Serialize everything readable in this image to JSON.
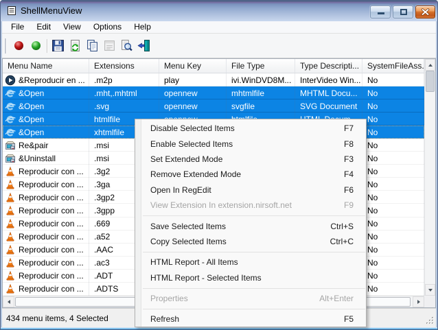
{
  "window": {
    "title": "ShellMenuView"
  },
  "menubar": {
    "items": [
      "File",
      "Edit",
      "View",
      "Options",
      "Help"
    ]
  },
  "toolbar": {
    "buttons": [
      {
        "name": "disable-selected",
        "icon": "red-circle-icon",
        "enabled": true
      },
      {
        "name": "enable-selected",
        "icon": "green-circle-icon",
        "enabled": true
      },
      {
        "name": "separator"
      },
      {
        "name": "save",
        "icon": "save-icon",
        "enabled": true
      },
      {
        "name": "refresh",
        "icon": "refresh-icon",
        "enabled": true
      },
      {
        "name": "copy",
        "icon": "copy-icon",
        "enabled": true
      },
      {
        "name": "properties",
        "icon": "properties-icon",
        "enabled": false
      },
      {
        "name": "find",
        "icon": "find-icon",
        "enabled": true
      },
      {
        "name": "exit",
        "icon": "exit-icon",
        "enabled": true
      }
    ]
  },
  "table": {
    "columns": [
      {
        "label": "Menu Name",
        "width": 126
      },
      {
        "label": "Extensions",
        "width": 102
      },
      {
        "label": "Menu Key",
        "width": 98
      },
      {
        "label": "File Type",
        "width": 100
      },
      {
        "label": "Type Descripti...",
        "width": 98
      },
      {
        "label": "SystemFileAss.",
        "width": 90
      }
    ],
    "rows": [
      {
        "icon": "windvd-icon",
        "selected": false,
        "focused": false,
        "cells": [
          "&Reproducir en ...",
          ".m2p",
          "play",
          "ivi.WinDVD8M...",
          "InterVideo Win...",
          "No"
        ]
      },
      {
        "icon": "ie-icon",
        "selected": true,
        "focused": false,
        "cells": [
          "&Open",
          ".mht,.mhtml",
          "opennew",
          "mhtmlfile",
          "MHTML Docu...",
          "No"
        ]
      },
      {
        "icon": "ie-icon",
        "selected": true,
        "focused": false,
        "cells": [
          "&Open",
          ".svg",
          "opennew",
          "svgfile",
          "SVG Document",
          "No"
        ]
      },
      {
        "icon": "ie-icon",
        "selected": true,
        "focused": false,
        "cells": [
          "&Open",
          "htmlfile",
          "opennew",
          "htmlfile",
          "HTML Docum...",
          "No"
        ]
      },
      {
        "icon": "ie-icon",
        "selected": true,
        "focused": true,
        "cells": [
          "&Open",
          "xhtmlfile",
          "",
          "",
          "",
          "No"
        ]
      },
      {
        "icon": "msi-icon",
        "selected": false,
        "focused": false,
        "cells": [
          "Re&pair",
          ".msi",
          "",
          "",
          "",
          "No"
        ]
      },
      {
        "icon": "msi-icon",
        "selected": false,
        "focused": false,
        "cells": [
          "&Uninstall",
          ".msi",
          "",
          "",
          "",
          "No"
        ]
      },
      {
        "icon": "vlc-icon",
        "selected": false,
        "focused": false,
        "cells": [
          "Reproducir con ...",
          ".3g2",
          "",
          "",
          "",
          "No"
        ]
      },
      {
        "icon": "vlc-icon",
        "selected": false,
        "focused": false,
        "cells": [
          "Reproducir con ...",
          ".3ga",
          "",
          "",
          "",
          "No"
        ]
      },
      {
        "icon": "vlc-icon",
        "selected": false,
        "focused": false,
        "cells": [
          "Reproducir con ...",
          ".3gp2",
          "",
          "",
          "",
          "No"
        ]
      },
      {
        "icon": "vlc-icon",
        "selected": false,
        "focused": false,
        "cells": [
          "Reproducir con ...",
          ".3gpp",
          "",
          "",
          "",
          "No"
        ]
      },
      {
        "icon": "vlc-icon",
        "selected": false,
        "focused": false,
        "cells": [
          "Reproducir con ...",
          ".669",
          "",
          "",
          "",
          "No"
        ]
      },
      {
        "icon": "vlc-icon",
        "selected": false,
        "focused": false,
        "cells": [
          "Reproducir con ...",
          ".a52",
          "",
          "",
          "",
          "No"
        ]
      },
      {
        "icon": "vlc-icon",
        "selected": false,
        "focused": false,
        "cells": [
          "Reproducir con ...",
          ".AAC",
          "",
          "",
          "",
          "No"
        ]
      },
      {
        "icon": "vlc-icon",
        "selected": false,
        "focused": false,
        "cells": [
          "Reproducir con ...",
          ".ac3",
          "",
          "",
          "",
          "No"
        ]
      },
      {
        "icon": "vlc-icon",
        "selected": false,
        "focused": false,
        "cells": [
          "Reproducir con ...",
          ".ADT",
          "",
          "",
          "",
          "No"
        ]
      },
      {
        "icon": "vlc-icon",
        "selected": false,
        "focused": false,
        "cells": [
          "Reproducir con ...",
          ".ADTS",
          "",
          "",
          "",
          "No"
        ]
      }
    ]
  },
  "context_menu": {
    "items": [
      {
        "label": "Disable Selected Items",
        "shortcut": "F7",
        "enabled": true
      },
      {
        "label": "Enable Selected Items",
        "shortcut": "F8",
        "enabled": true
      },
      {
        "label": "Set Extended Mode",
        "shortcut": "F3",
        "enabled": true
      },
      {
        "label": "Remove Extended Mode",
        "shortcut": "F4",
        "enabled": true
      },
      {
        "label": "Open In RegEdit",
        "shortcut": "F6",
        "enabled": true
      },
      {
        "label": "View Extension In extension.nirsoft.net",
        "shortcut": "F9",
        "enabled": false
      },
      {
        "type": "separator"
      },
      {
        "label": "Save Selected Items",
        "shortcut": "Ctrl+S",
        "enabled": true
      },
      {
        "label": "Copy Selected Items",
        "shortcut": "Ctrl+C",
        "enabled": true
      },
      {
        "type": "separator"
      },
      {
        "label": "HTML Report - All Items",
        "shortcut": "",
        "enabled": true
      },
      {
        "label": "HTML Report - Selected Items",
        "shortcut": "",
        "enabled": true
      },
      {
        "type": "separator"
      },
      {
        "label": "Properties",
        "shortcut": "Alt+Enter",
        "enabled": false
      },
      {
        "type": "separator"
      },
      {
        "label": "Refresh",
        "shortcut": "F5",
        "enabled": true
      }
    ]
  },
  "status_bar": {
    "text": "434 menu items, 4 Selected"
  },
  "colors": {
    "selection": "#0c84e4",
    "close_button": "#d4702a",
    "titlebar_top": "#54698d"
  }
}
